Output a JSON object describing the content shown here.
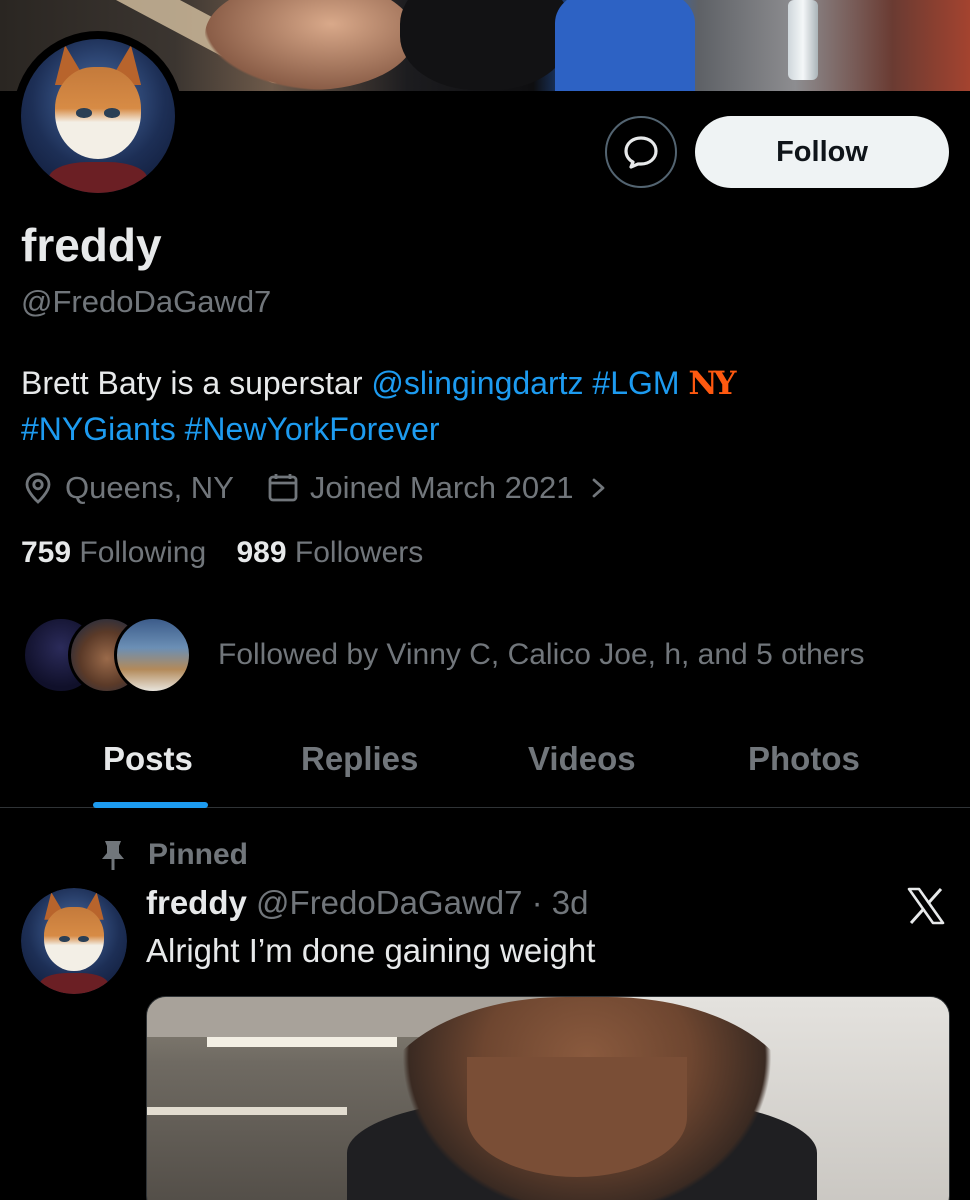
{
  "profile": {
    "name": "freddy",
    "handle": "@FredoDaGawd7",
    "follow_label": "Follow",
    "bio": {
      "text": "Brett Baty is a superstar ",
      "mention": "@slingingdartz",
      "tag1": "#LGM",
      "tag2": "#NYGiants",
      "tag3": "#NewYorkForever"
    },
    "location": "Queens, NY",
    "joined": "Joined March 2021",
    "following_count": "759",
    "following_label": "Following",
    "followers_count": "989",
    "followers_label": "Followers",
    "followed_by": "Followed by Vinny C, Calico Joe, h, and 5 others"
  },
  "tabs": [
    "Posts",
    "Replies",
    "Videos",
    "Photos"
  ],
  "post": {
    "pinned_label": "Pinned",
    "author": "freddy",
    "handle_time": "@FredoDaGawd7 · 3d",
    "text": "Alright I’m done gaining weight"
  },
  "colors": {
    "accent": "#1d9bf0",
    "muted": "#71767b",
    "text": "#e7e9ea",
    "mets_orange": "#ff5910"
  },
  "icons": {
    "message": "message-icon",
    "location": "location-pin-icon",
    "calendar": "calendar-icon",
    "chevron": "chevron-right-icon",
    "pin": "pin-icon",
    "x": "x-logo-icon"
  }
}
